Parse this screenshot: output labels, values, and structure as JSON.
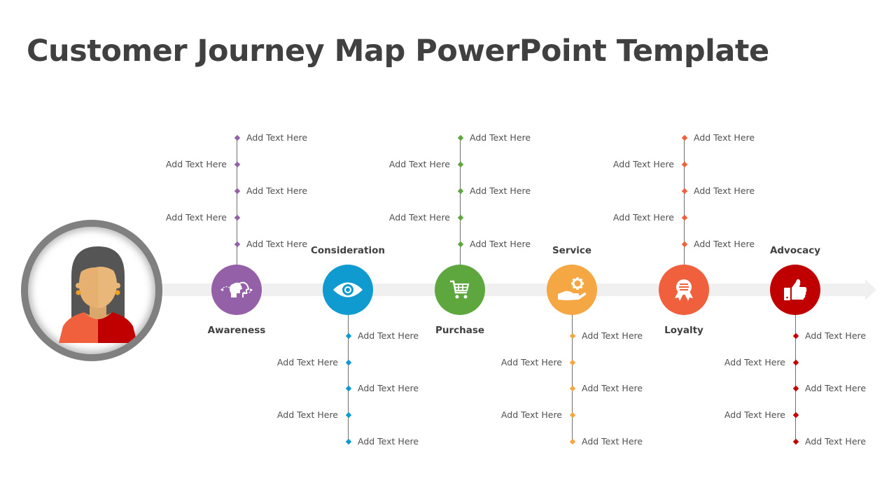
{
  "title": "Customer Journey Map PowerPoint Template",
  "persona": {
    "icon": "woman-avatar-icon"
  },
  "stages": [
    {
      "name": "Awareness",
      "color": "#9460a8",
      "icon": "mind-heads-icon",
      "branch": "up",
      "points": [
        "Add Text Here",
        "Add Text Here",
        "Add Text Here",
        "Add Text Here",
        "Add Text Here"
      ]
    },
    {
      "name": "Consideration",
      "color": "#0f9bd0",
      "icon": "eye-icon",
      "branch": "down",
      "points": [
        "Add Text Here",
        "Add Text Here",
        "Add Text Here",
        "Add Text Here",
        "Add Text Here"
      ]
    },
    {
      "name": "Purchase",
      "color": "#5ea63e",
      "icon": "shopping-cart-icon",
      "branch": "up",
      "points": [
        "Add Text Here",
        "Add Text Here",
        "Add Text Here",
        "Add Text Here",
        "Add Text Here"
      ]
    },
    {
      "name": "Service",
      "color": "#f4a742",
      "icon": "hand-gear-icon",
      "branch": "down",
      "points": [
        "Add Text Here",
        "Add Text Here",
        "Add Text Here",
        "Add Text Here",
        "Add Text Here"
      ]
    },
    {
      "name": "Loyalty",
      "color": "#f0603c",
      "icon": "award-badge-icon",
      "branch": "up",
      "points": [
        "Add Text Here",
        "Add Text Here",
        "Add Text Here",
        "Add Text Here",
        "Add Text Here"
      ]
    },
    {
      "name": "Advocacy",
      "color": "#c00000",
      "icon": "thumbs-up-icon",
      "branch": "down",
      "points": [
        "Add Text Here",
        "Add Text Here",
        "Add Text Here",
        "Add Text Here",
        "Add Text Here"
      ]
    }
  ]
}
